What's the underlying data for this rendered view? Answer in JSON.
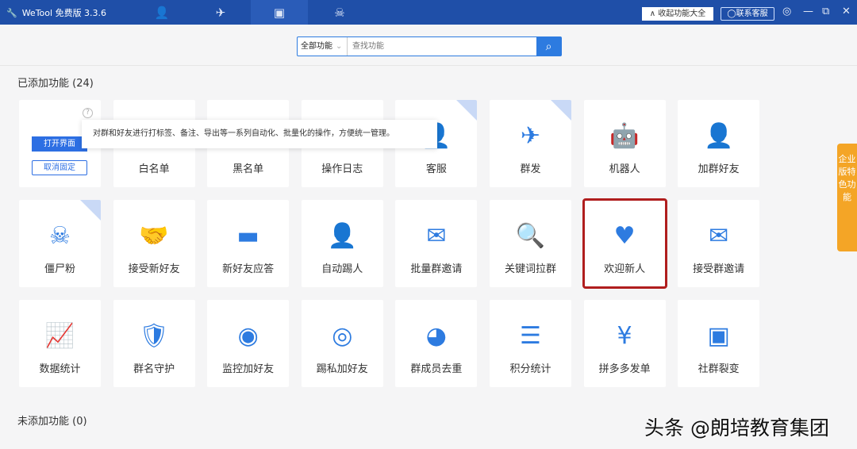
{
  "app": {
    "title": "WeTool 免费版 3.3.6"
  },
  "topbar": {
    "collapse": "∧ 收起功能大全",
    "contact": "◯联系客服"
  },
  "search": {
    "category": "全部功能",
    "placeholder": "查找功能"
  },
  "added": {
    "title": "已添加功能 (24)"
  },
  "not_added": {
    "title": "未添加功能 (0)"
  },
  "first_card": {
    "open": "打开界面",
    "unpin": "取消固定",
    "help": "?"
  },
  "tooltip": "对群和好友进行打标签、备注、导出等一系列自动化、批量化的操作，方便统一管理。",
  "cards": [
    {
      "label": "",
      "icon": ""
    },
    {
      "label": "白名单",
      "icon": ""
    },
    {
      "label": "黑名单",
      "icon": ""
    },
    {
      "label": "操作日志",
      "icon": ""
    },
    {
      "label": "客服",
      "icon": "👤"
    },
    {
      "label": "群发",
      "icon": "✈"
    },
    {
      "label": "机器人",
      "icon": "🤖"
    },
    {
      "label": "加群好友",
      "icon": "👤"
    },
    {
      "label": "僵尸粉",
      "icon": "☠"
    },
    {
      "label": "接受新好友",
      "icon": "🤝"
    },
    {
      "label": "新好友应答",
      "icon": "▬"
    },
    {
      "label": "自动踢人",
      "icon": "👤"
    },
    {
      "label": "批量群邀请",
      "icon": "✉"
    },
    {
      "label": "关键词拉群",
      "icon": "🔍"
    },
    {
      "label": "欢迎新人",
      "icon": "♥"
    },
    {
      "label": "接受群邀请",
      "icon": "✉"
    },
    {
      "label": "数据统计",
      "icon": "📈"
    },
    {
      "label": "群名守护",
      "icon": "🛡"
    },
    {
      "label": "监控加好友",
      "icon": "◉"
    },
    {
      "label": "踢私加好友",
      "icon": "◎"
    },
    {
      "label": "群成员去重",
      "icon": "◕"
    },
    {
      "label": "积分统计",
      "icon": "☰"
    },
    {
      "label": "拼多多发单",
      "icon": "¥"
    },
    {
      "label": "社群裂变",
      "icon": "▣"
    }
  ],
  "side_tab": "企业版特色功能",
  "watermark": "头条 @朗培教育集团"
}
